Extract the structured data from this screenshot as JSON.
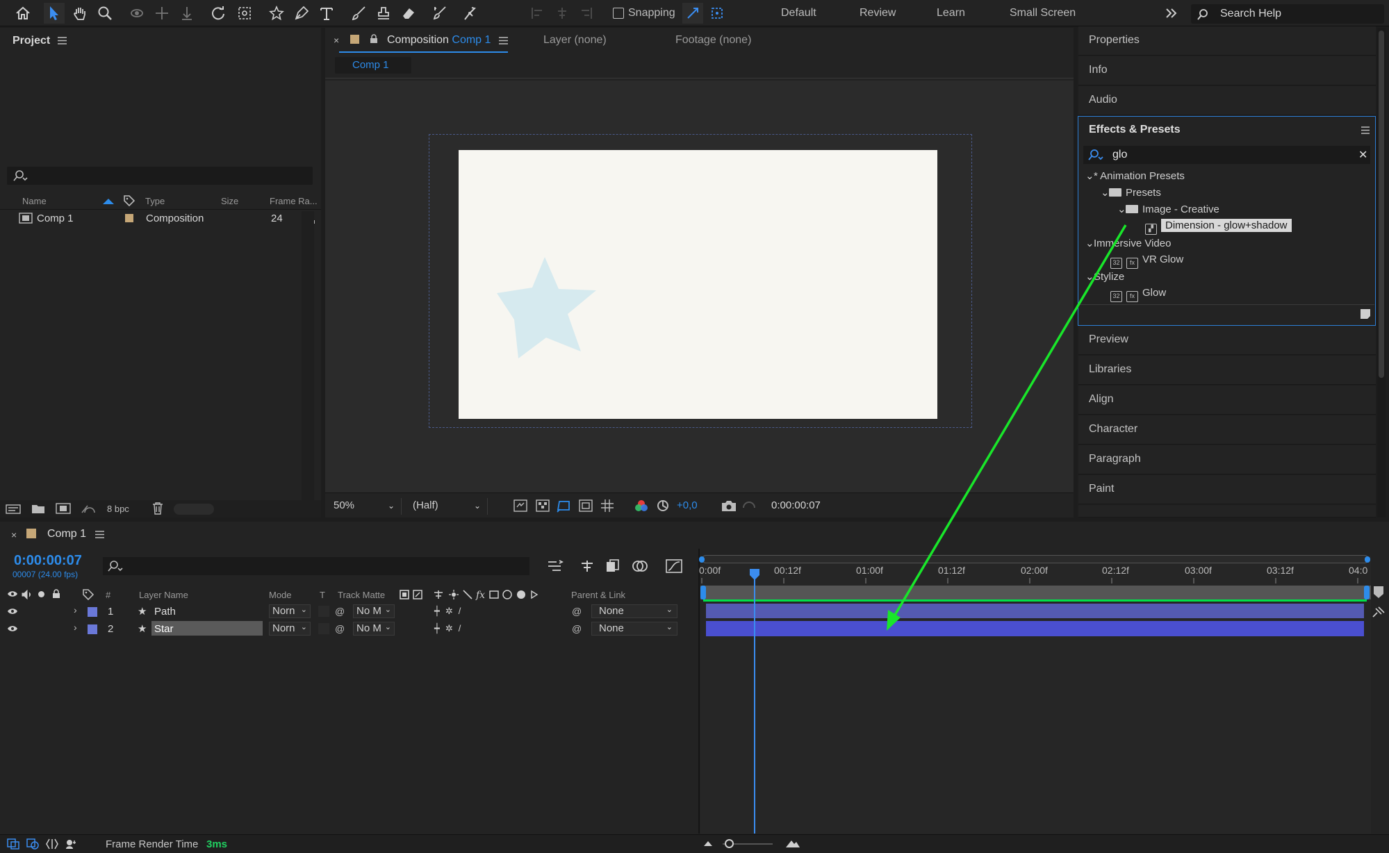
{
  "toolbar": {
    "snapping_label": "Snapping",
    "workspaces": [
      "Default",
      "Review",
      "Learn",
      "Small Screen"
    ],
    "more_icon": "double-chevron-right-icon",
    "search_placeholder": "Search Help"
  },
  "project": {
    "title": "Project",
    "columns": [
      "Name",
      "Type",
      "Size",
      "Frame Ra..."
    ],
    "items": [
      {
        "name": "Comp 1",
        "type": "Composition",
        "frame_rate": "24"
      }
    ],
    "footer_bpc": "8 bpc"
  },
  "viewer": {
    "tabs": [
      {
        "prefix": "Composition",
        "name": "Comp 1"
      },
      {
        "label": "Layer (none)"
      },
      {
        "label": "Footage (none)"
      }
    ],
    "sub_tab": "Comp 1",
    "canvas_color": "#f7f6f1",
    "star_color": "#d6eaef",
    "footer": {
      "zoom": "50%",
      "resolution": "(Half)",
      "exposure": "+0,0",
      "timecode": "0:00:00:07"
    }
  },
  "right_panels": {
    "top": [
      "Properties",
      "Info",
      "Audio"
    ],
    "effects": {
      "title": "Effects & Presets",
      "search_value": "glo",
      "tree": [
        {
          "label": "* Animation Presets",
          "level": 0,
          "kind": "category"
        },
        {
          "label": "Presets",
          "level": 1,
          "kind": "folder"
        },
        {
          "label": "Image - Creative",
          "level": 2,
          "kind": "folder"
        },
        {
          "label": "Dimension - glow+shadow",
          "level": 3,
          "kind": "preset",
          "selected": true
        },
        {
          "label": "Immersive Video",
          "level": 0,
          "kind": "category"
        },
        {
          "label": "VR Glow",
          "level": 1,
          "kind": "effect"
        },
        {
          "label": "Stylize",
          "level": 0,
          "kind": "category"
        },
        {
          "label": "Glow",
          "level": 1,
          "kind": "effect"
        }
      ]
    },
    "bottom": [
      "Preview",
      "Libraries",
      "Align",
      "Character",
      "Paragraph",
      "Paint"
    ]
  },
  "timeline": {
    "comp_name": "Comp 1",
    "timecode": "0:00:00:07",
    "frame_info": "00007 (24.00 fps)",
    "columns": {
      "num": "#",
      "layer_name": "Layer Name",
      "mode": "Mode",
      "t": "T",
      "track_matte": "Track Matte",
      "parent": "Parent & Link"
    },
    "layers": [
      {
        "num": "1",
        "name": "Path",
        "mode": "Norn",
        "matte": "No M",
        "parent": "None",
        "color": "#6a78d8"
      },
      {
        "num": "2",
        "name": "Star",
        "mode": "Norn",
        "matte": "No M",
        "parent": "None",
        "color": "#6a78d8",
        "selected": true
      }
    ],
    "ruler": [
      "0:00f",
      "00:12f",
      "01:00f",
      "01:12f",
      "02:00f",
      "02:12f",
      "03:00f",
      "03:12f",
      "04:0"
    ],
    "playhead_frame": 7,
    "bar_color": "#4a4fb8",
    "work_area_color": "#00e04a"
  },
  "status": {
    "label": "Frame Render Time",
    "value": "3ms"
  },
  "annotation": {
    "arrow_color": "#19e62a"
  }
}
